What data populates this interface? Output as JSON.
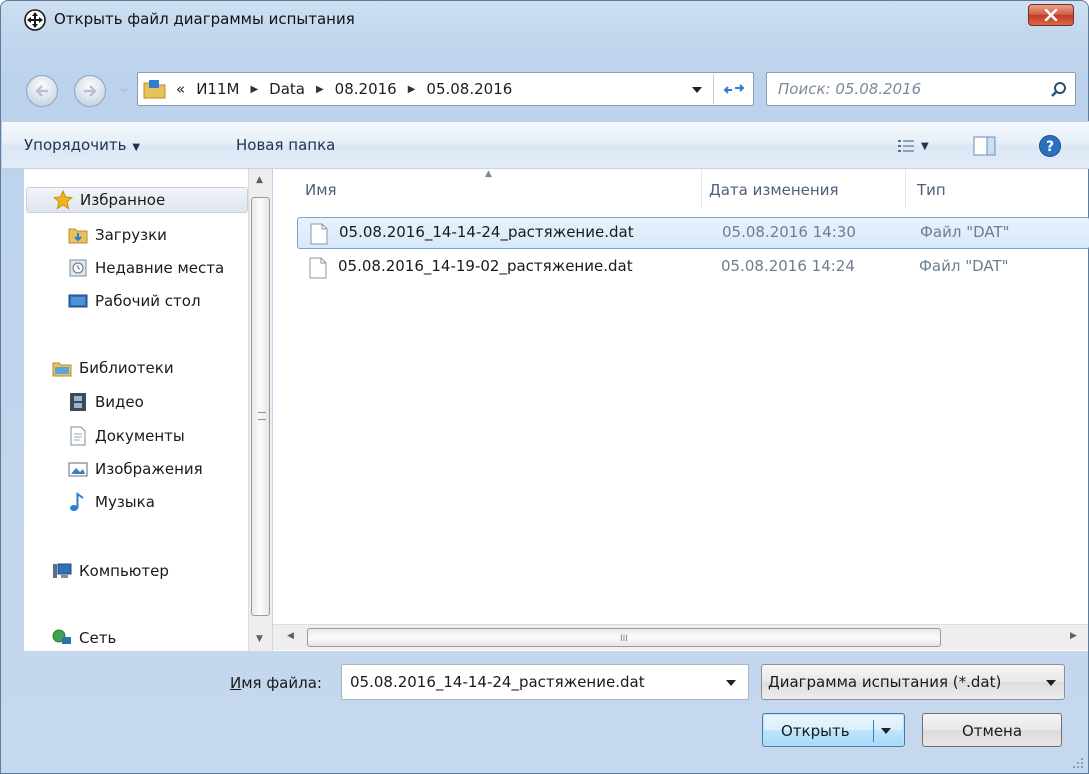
{
  "window": {
    "title": "Открыть файл диаграммы испытания"
  },
  "address": {
    "overflow": "«",
    "crumbs": [
      "И11М",
      "Data",
      "08.2016",
      "05.08.2016"
    ]
  },
  "search": {
    "placeholder": "Поиск: 05.08.2016"
  },
  "toolbar": {
    "organize_label": "Упорядочить",
    "new_folder_label": "Новая папка"
  },
  "sidebar": {
    "favorites": "Избранное",
    "downloads": "Загрузки",
    "recent": "Недавние места",
    "desktop": "Рабочий стол",
    "libraries": "Библиотеки",
    "video": "Видео",
    "documents": "Документы",
    "pictures": "Изображения",
    "music": "Музыка",
    "computer": "Компьютер",
    "network": "Сеть"
  },
  "columns": {
    "name": "Имя",
    "date": "Дата изменения",
    "type": "Тип"
  },
  "files": [
    {
      "name": "05.08.2016_14-14-24_растяжение.dat",
      "date": "05.08.2016 14:30",
      "type": "Файл \"DAT\""
    },
    {
      "name": "05.08.2016_14-19-02_растяжение.dat",
      "date": "05.08.2016 14:24",
      "type": "Файл \"DAT\""
    }
  ],
  "bottom": {
    "filename_label_accel": "И",
    "filename_label_rest": "мя файла:",
    "filename_value": "05.08.2016_14-14-24_растяжение.dat",
    "filter": "Диаграмма испытания (*.dat)",
    "open_label": "Открыть",
    "cancel_label": "Отмена"
  },
  "hscroll_grip": "III"
}
